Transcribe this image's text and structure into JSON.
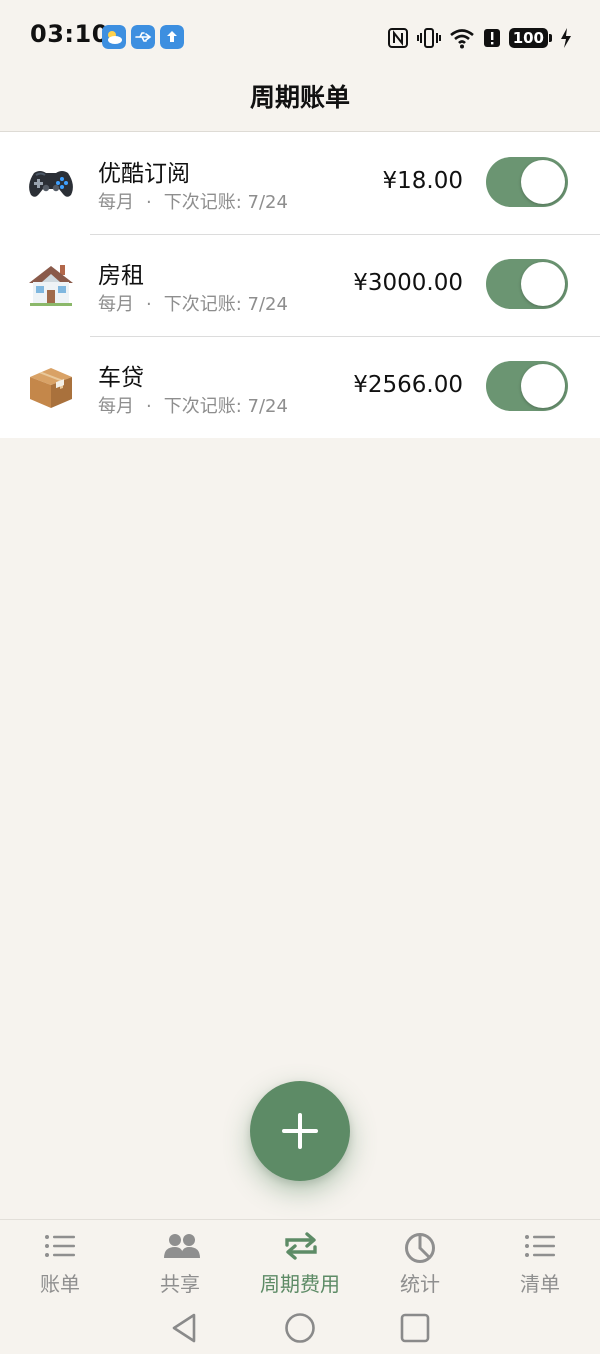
{
  "status_bar": {
    "time": "03:10",
    "battery": "100"
  },
  "header": {
    "title": "周期账单"
  },
  "bills": [
    {
      "name": "优酷订阅",
      "frequency": "每月",
      "separator": "·",
      "next": "下次记账: 7/24",
      "amount": "¥18.00",
      "icon": "gamepad-icon",
      "enabled": true
    },
    {
      "name": "房租",
      "frequency": "每月",
      "separator": "·",
      "next": "下次记账: 7/24",
      "amount": "¥3000.00",
      "icon": "house-icon",
      "enabled": true
    },
    {
      "name": "车贷",
      "frequency": "每月",
      "separator": "·",
      "next": "下次记账: 7/24",
      "amount": "¥2566.00",
      "icon": "package-box-icon",
      "enabled": true
    }
  ],
  "fab": {
    "icon": "plus-icon"
  },
  "bottom_nav": {
    "items": [
      {
        "label": "账单",
        "icon": "list-icon",
        "active": false
      },
      {
        "label": "共享",
        "icon": "people-icon",
        "active": false
      },
      {
        "label": "周期费用",
        "icon": "repeat-icon",
        "active": true
      },
      {
        "label": "统计",
        "icon": "pie-chart-icon",
        "active": false
      },
      {
        "label": "清单",
        "icon": "list-icon",
        "active": false
      }
    ]
  },
  "colors": {
    "accent": "#5d8b66",
    "toggle_on": "#6b9572",
    "background": "#f6f3ee",
    "inactive": "#8f8f8f"
  }
}
